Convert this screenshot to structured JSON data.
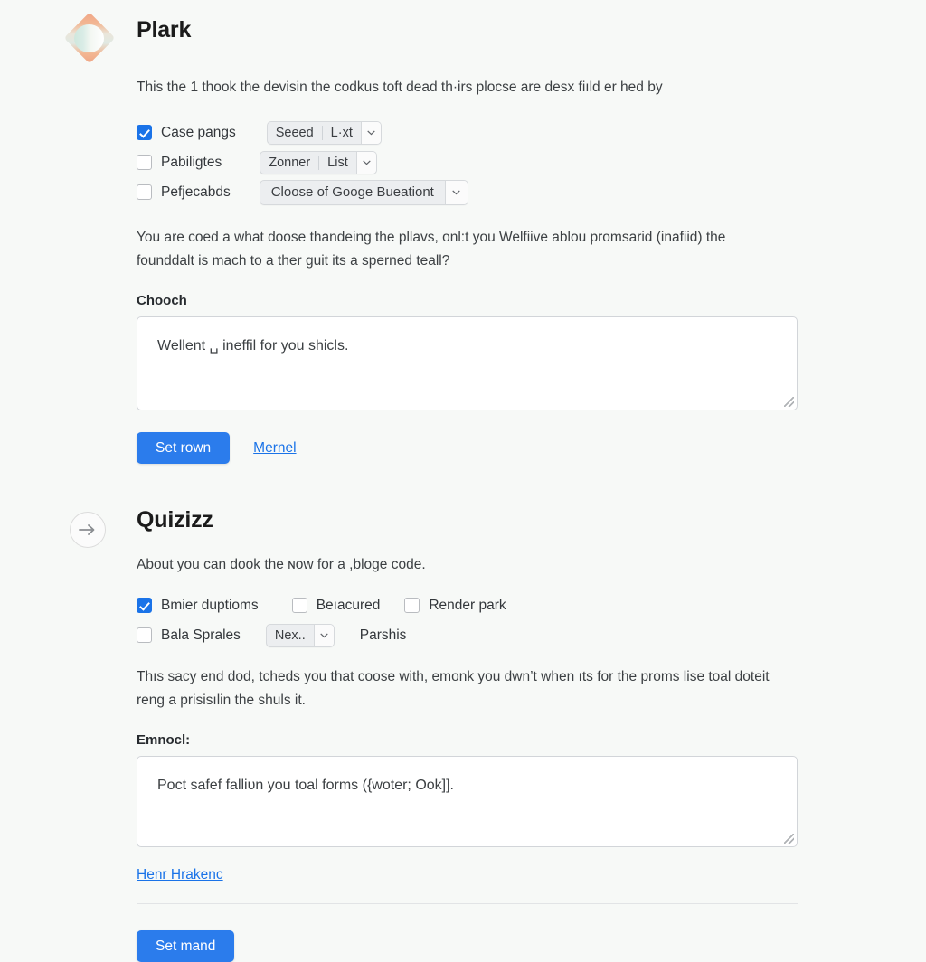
{
  "theme": {
    "accent": "#2b7cec",
    "link": "#1a73e8",
    "checkbox_checked": "#1a73e8",
    "page_bg": "#f7f9f7"
  },
  "sections": [
    {
      "icon": "plark-logo-icon",
      "title": "Plark",
      "intro": "This the 1 thook the devisin the codkus toft dead th·irs plocse are desx fiıld er hed by",
      "options": [
        {
          "checked": true,
          "label": "Case pangs",
          "control": {
            "type": "split-dropdown",
            "left": "Seeed",
            "right": "L·xt",
            "caret": "chevron-down-icon"
          }
        },
        {
          "checked": false,
          "label": "Pabiligtes",
          "control": {
            "type": "split-dropdown",
            "left": "Zonner",
            "right": "List",
            "caret": "chevron-down-icon"
          }
        },
        {
          "checked": false,
          "label": "Pefjecabds",
          "control": {
            "type": "dropdown",
            "left": "Cloose of Googe Bueationt",
            "caret": "chevron-down-icon"
          }
        }
      ],
      "body": "You are coed a what doose thandeing the pllavѕ, onl:t you Welfiive ablou promsarid (inafiid) the founddalt is mach to a ther guit its a sperned teall?",
      "field_label": "Chooch",
      "textarea_value": "Wellent ␣ ineffil for you shicls.",
      "primary_button": "Set rown",
      "secondary_link": "Mernel"
    },
    {
      "icon": "arrow-right-circle-icon",
      "title": "Quizizz",
      "intro": "About you can dook the ɴow for a ,bloge code.",
      "options_row1": [
        {
          "checked": true,
          "label": "Bmier duptioms"
        },
        {
          "checked": false,
          "label": "Bеıacured"
        },
        {
          "checked": false,
          "label": "Render park"
        }
      ],
      "options_row2": {
        "checkbox": {
          "checked": false,
          "label": "Bala Sprales"
        },
        "control": {
          "type": "dropdown",
          "left": "Nex..",
          "caret": "chevron-down-icon"
        },
        "trailing_label": "Parshis"
      },
      "body": "Thıs sacy end dod, tcheds you that coose with, emonk you dwn’t when ıts for the proms lise toal doteit reng a prisisılin the shuls it.",
      "field_label": "Emnocl:",
      "textarea_value": "Poct safef falliᴜn you toal forms ({woter; Ook]].",
      "footer_link": "Henr Hrakenс",
      "primary_button": "Set mand"
    }
  ]
}
